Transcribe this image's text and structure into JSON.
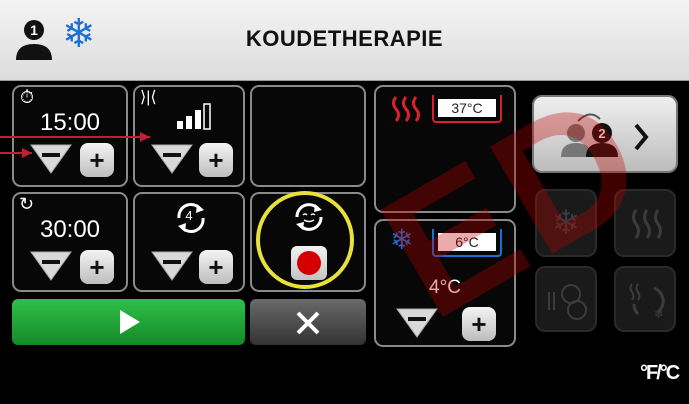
{
  "header": {
    "title": "KOUDETHERAPIE",
    "user_icon": "user-1-icon",
    "mode_icon": "snowflake-icon"
  },
  "timer1": {
    "value": "15:00",
    "icon": "stopwatch-icon"
  },
  "intensity": {
    "icon": "compression-icon",
    "level": 3,
    "max_level": 4
  },
  "timer2": {
    "value": "30:00",
    "icon": "cycle-timer-icon"
  },
  "cycles": {
    "value": "4",
    "icon": "repeat-icon"
  },
  "record": {
    "icon": "auto-cycle-icon",
    "color": "#d40000"
  },
  "warm_tank": {
    "temp": "37°C",
    "icon": "heat-icon",
    "color": "#d9202b"
  },
  "cold_tank": {
    "temp": "6°C",
    "icon": "snowflake-icon",
    "color": "#1c6fd6"
  },
  "setpoint": {
    "value": "4°C"
  },
  "unit_toggle": "°F/°C",
  "watermark": "ED",
  "colors": {
    "start": "#1fa035",
    "highlight": "#e8e03c",
    "arrow": "#c21d35"
  }
}
